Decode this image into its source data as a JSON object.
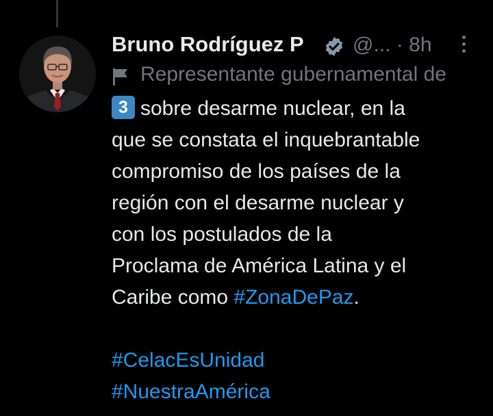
{
  "tweet": {
    "author_name": "Bruno Rodríguez P",
    "handle": "@...",
    "separator": "·",
    "time": "8h",
    "label": "Representante gubernamental de",
    "keycap_emoji": "3",
    "body_lines": [
      "sobre desarme nuclear, en la",
      "que se constata el inquebrantable",
      "compromiso de los países de la",
      "región con el desarme nuclear y",
      "con los postulados de la",
      "Proclama de América Latina y el"
    ],
    "last_line_prefix": "Caribe como ",
    "inline_hashtag": "#ZonaDePaz",
    "last_line_suffix": ".",
    "hashtags": [
      "#CelacEsUnidad",
      "#NuestraAmérica"
    ]
  },
  "colors": {
    "background": "#000000",
    "text": "#e7e9ea",
    "secondary": "#71767b",
    "link": "#1d9bf0",
    "verified_badge": "#829aab"
  },
  "icons": {
    "verified": "verified-badge-icon",
    "more": "more-options-icon",
    "label": "flag-icon",
    "keycap": "keycap-3-emoji"
  }
}
